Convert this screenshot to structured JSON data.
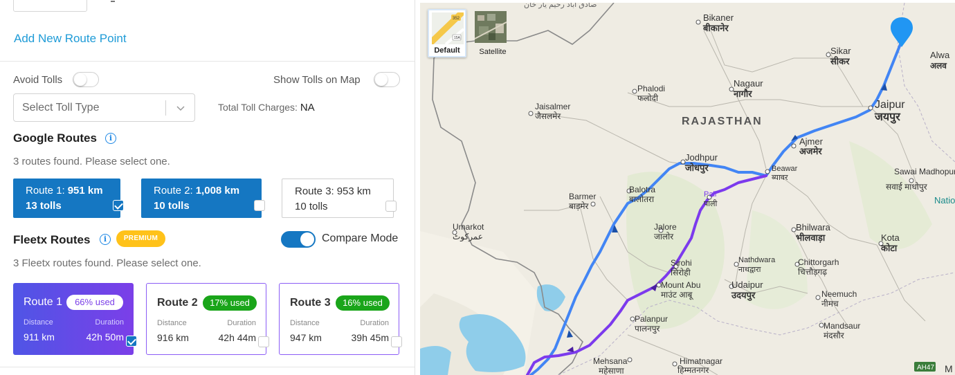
{
  "left_panel": {
    "add_route_point": "Add New Route Point",
    "avoid_tolls_label": "Avoid Tolls",
    "show_tolls_label": "Show Tolls on Map",
    "toll_type_placeholder": "Select Toll Type",
    "total_toll_label": "Total Toll Charges:",
    "total_toll_value": "NA",
    "google": {
      "title": "Google Routes",
      "hint": "3 routes found. Please select one.",
      "routes": [
        {
          "name": "Route 1:",
          "distance": "951 km",
          "tolls": "13 tolls",
          "selected": true
        },
        {
          "name": "Route 2:",
          "distance": "1,008 km",
          "tolls": "10 tolls",
          "selected": true
        },
        {
          "name": "Route 3:",
          "distance": "953 km",
          "tolls": "10 tolls",
          "selected": false
        }
      ]
    },
    "fleetx": {
      "title": "Fleetx Routes",
      "premium_badge": "PREMIUM",
      "compare_mode_label": "Compare Mode",
      "compare_mode_on": true,
      "hint": "3 Fleetx routes found. Please select one.",
      "distance_label": "Distance",
      "duration_label": "Duration",
      "routes": [
        {
          "name": "Route 1",
          "usage": "66% used",
          "distance": "911 km",
          "duration": "42h 50m",
          "selected": true
        },
        {
          "name": "Route 2",
          "usage": "17% used",
          "distance": "916 km",
          "duration": "42h 44m",
          "selected": false
        },
        {
          "name": "Route 3",
          "usage": "16% used",
          "distance": "947 km",
          "duration": "39h 45m",
          "selected": false
        }
      ]
    }
  },
  "map": {
    "map_types": [
      {
        "label": "Default",
        "active": true
      },
      {
        "label": "Satellite",
        "active": false
      }
    ],
    "region_label": "RAJASTHAN",
    "places": [
      {
        "en": "Bikaner",
        "local": "बीकानेर"
      },
      {
        "en": "Sikar",
        "local": "सीकर"
      },
      {
        "en": "Alwa",
        "local": "अलव"
      },
      {
        "en": "Nagaur",
        "local": "नागौर"
      },
      {
        "en": "Phalodi",
        "local": "फलोदी"
      },
      {
        "en": "Jaisalmer",
        "local": "जैसलमेर"
      },
      {
        "en": "Jaipur",
        "local": "जयपुर"
      },
      {
        "en": "Ajmer",
        "local": "अजमेर"
      },
      {
        "en": "Jodhpur",
        "local": "जोधपुर"
      },
      {
        "en": "Beawar",
        "local": "ब्यावर"
      },
      {
        "en": "Sawai Madhopur",
        "local": "सवाई माधोपुर"
      },
      {
        "en": "Barmer",
        "local": "बाड़मेर"
      },
      {
        "en": "Balotra",
        "local": "बालोतरा"
      },
      {
        "en": "Pali",
        "local": "पाली"
      },
      {
        "en": "Umarkot",
        "local": "عمرکوٹ"
      },
      {
        "en": "Jalore",
        "local": "जालोर"
      },
      {
        "en": "Bhilwara",
        "local": "भीलवाड़ा"
      },
      {
        "en": "Kota",
        "local": "कोटा"
      },
      {
        "en": "Sirohi",
        "local": "सिरोही"
      },
      {
        "en": "Nathdwara",
        "local": "नाथद्वारा"
      },
      {
        "en": "Chittorgarh",
        "local": "चित्तौड़गढ़"
      },
      {
        "en": "Mount Abu",
        "local": "माउंट आबू"
      },
      {
        "en": "Udaipur",
        "local": "उदयपुर"
      },
      {
        "en": "Neemuch",
        "local": "नीमच"
      },
      {
        "en": "Palanpur",
        "local": "पालनपुर"
      },
      {
        "en": "Mandsaur",
        "local": "मंदसौर"
      },
      {
        "en": "Mehsana",
        "local": "महेसाणा"
      },
      {
        "en": "Himatnagar",
        "local": "हिम्मतनगर"
      }
    ],
    "top_partial_label": "صادق آباد رحیم یار خان",
    "nati_label": "Natio",
    "highway_shield": "AH47",
    "shield_352": "352",
    "shield_15a": "15A",
    "edge_letter": "M",
    "colors": {
      "route_blue": "#4285f4",
      "route_purple": "#7c3aed",
      "marker": "#2196f3",
      "water": "#8fcdea"
    }
  }
}
